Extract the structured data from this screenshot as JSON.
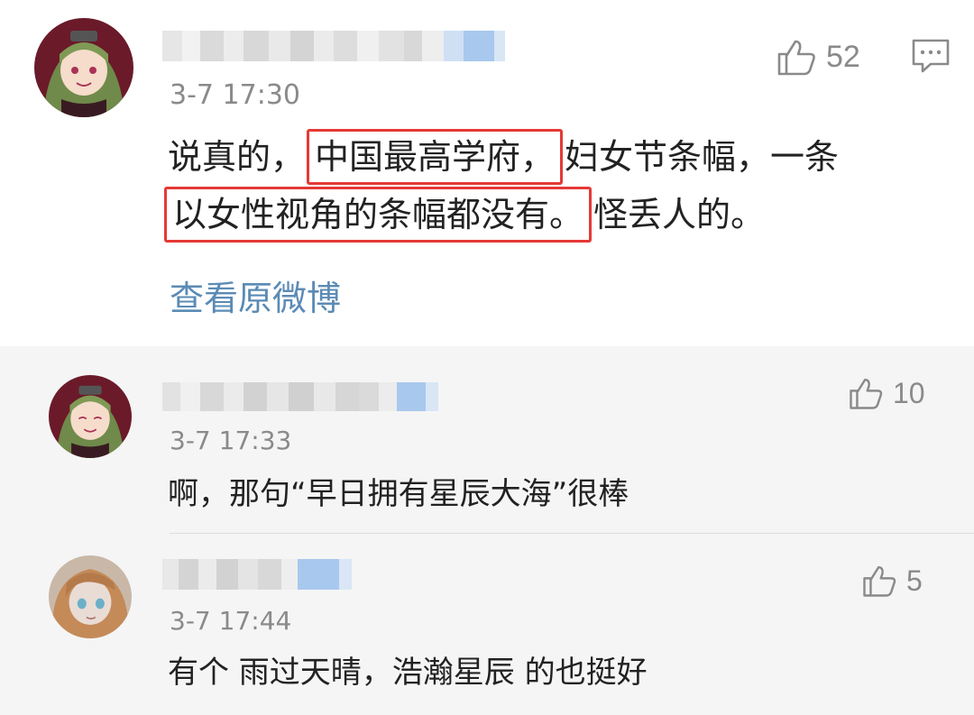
{
  "main_comment": {
    "username": "",
    "timestamp": "3-7 17:30",
    "text_part1": "说真的，",
    "text_highlight1": "中国最高学府，",
    "text_part2": "妇女节条幅，一条",
    "text_highlight2": "以女性视角的条幅都没有。",
    "text_part3": "怪丢人的。",
    "likes": "52",
    "view_original": "查看原微博",
    "icons": {
      "like": "thumbs-up-icon",
      "reply": "comment-icon"
    },
    "highlight_color": "#e53935",
    "link_color": "#5b8bb5"
  },
  "replies": [
    {
      "timestamp": "3-7 17:33",
      "text": "啊，那句“早日拥有星辰大海”很棒",
      "likes": "10"
    },
    {
      "timestamp": "3-7 17:44",
      "text": "有个 雨过天晴，浩瀚星辰 的也挺好",
      "likes": "5"
    }
  ]
}
